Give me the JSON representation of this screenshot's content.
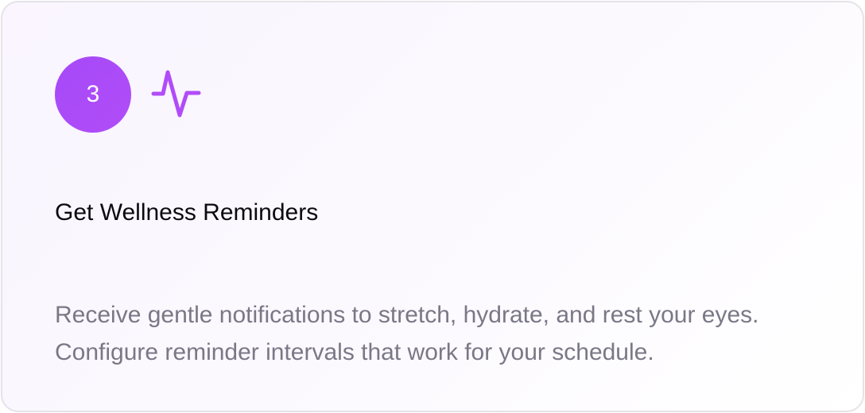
{
  "step": {
    "number": "3",
    "icon": "activity-icon"
  },
  "card": {
    "title": "Get Wellness Reminders",
    "description": "Receive gentle notifications to stretch, hydrate, and rest your eyes. Configure reminder intervals that work for your schedule."
  },
  "colors": {
    "accent": "#a64af7",
    "title": "#0b0b0f",
    "description": "#7a7886",
    "border": "#e5e3e8"
  }
}
